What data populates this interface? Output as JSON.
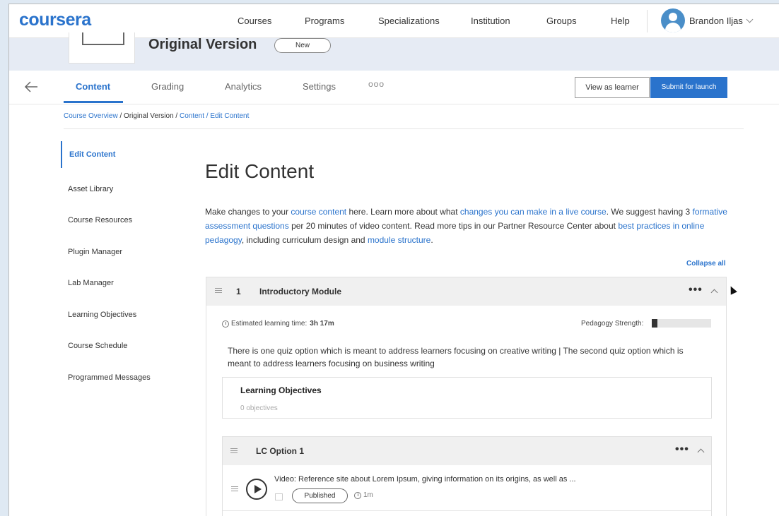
{
  "topnav": {
    "logo": "coursera",
    "links": [
      "Courses",
      "Programs",
      "Specializations",
      "Institution",
      "Groups",
      "Help"
    ],
    "user_name": "Brandon Iljas"
  },
  "course": {
    "title": "Original Version",
    "badge": "New"
  },
  "tabs": {
    "items": [
      "Content",
      "Grading",
      "Analytics",
      "Settings"
    ],
    "active": "Content",
    "more": "ooo",
    "view_as_learner": "View as learner",
    "submit": "Submit for launch"
  },
  "breadcrumb": {
    "course_overview": "Course Overview",
    "sep1": " / ",
    "current": "Original Version",
    "sep2": " / ",
    "content": "Content / Edit Content"
  },
  "sidenav": {
    "items": [
      "Edit Content",
      "Asset Library",
      "Course Resources",
      "Plugin Manager",
      "Lab Manager",
      "Learning Objectives",
      "Course Schedule",
      "Programmed Messages"
    ],
    "active": "Edit Content"
  },
  "main": {
    "title": "Edit Content",
    "intro": {
      "t1": "Make changes to your ",
      "l1": "course content",
      "t2": " here. Learn more about what ",
      "l2": "changes you can make in a live course",
      "t3": ". We suggest having 3 ",
      "l3": "formative assessment questions",
      "t4": " per 20 minutes of video content. Read more tips in our Partner Resource Center about ",
      "l4": "best practices in online pedagogy",
      "t5": ", including curriculum design and ",
      "l5": "module structure",
      "t6": "."
    },
    "collapse_all": "Collapse all"
  },
  "module": {
    "number": "1",
    "title": "Introductory Module",
    "est_label": "Estimated learning time:",
    "est_value": "3h 17m",
    "pedagogy_label": "Pedagogy Strength:",
    "pedagogy_strength": 0.1,
    "description": "There is one quiz option which is meant to address learners focusing on creative writing | The second quiz option which is meant to address learners focusing on business writing",
    "learning_objectives": {
      "title": "Learning Objectives",
      "count": "0 objectives"
    },
    "lesson": {
      "title": "LC Option 1",
      "video_title": "Video: Reference site about Lorem Ipsum, giving information on its origins, as well as ...",
      "status": "Published",
      "duration": "1m"
    }
  },
  "colors": {
    "brand": "#2a73cc",
    "header_band": "#e6ebf4",
    "card_header": "#f0f0f0"
  }
}
